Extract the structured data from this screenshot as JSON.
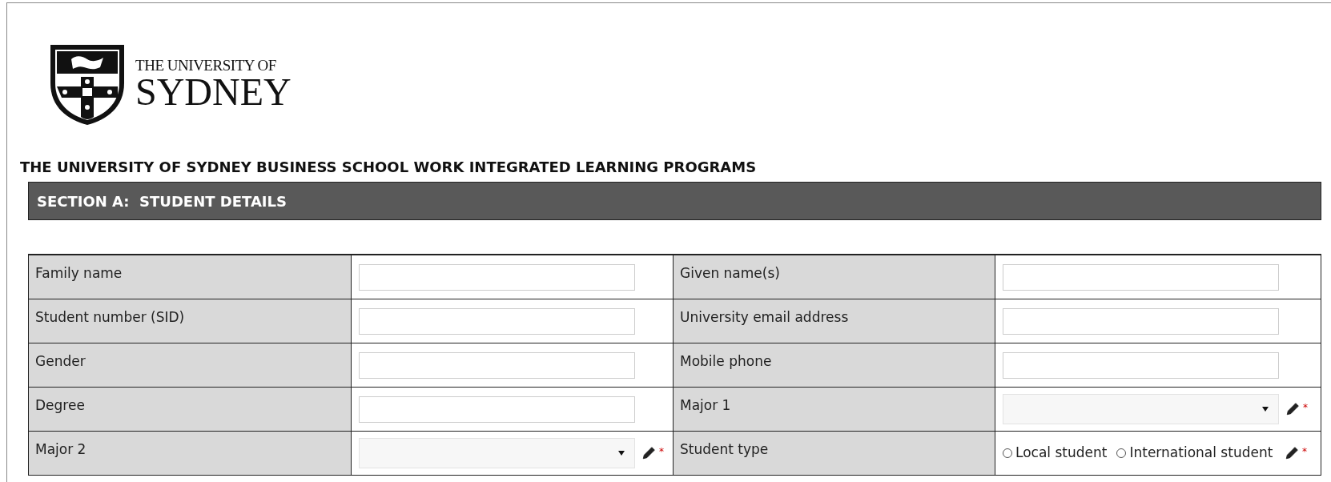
{
  "logo": {
    "line_1": "THE UNIVERSITY OF",
    "line_2": "SYDNEY"
  },
  "heading": "THE UNIVERSITY OF SYDNEY BUSINESS SCHOOL WORK INTEGRATED LEARNING PROGRAMS",
  "section_title": "SECTION A:  STUDENT DETAILS",
  "rows": [
    [
      {
        "label": "Family name",
        "kind": "text"
      },
      {
        "label": "Given name(s)",
        "kind": "text"
      }
    ],
    [
      {
        "label": "Student number (SID)",
        "kind": "text"
      },
      {
        "label": "University email address",
        "kind": "text"
      }
    ],
    [
      {
        "label": "Gender",
        "kind": "text"
      },
      {
        "label": "Mobile phone",
        "kind": "text"
      }
    ],
    [
      {
        "label": "Degree",
        "kind": "text"
      },
      {
        "label": "Major 1",
        "kind": "select",
        "required_mark": "*"
      }
    ],
    [
      {
        "label": "Major 2",
        "kind": "select",
        "required_mark": "*"
      },
      {
        "label": "Student type",
        "kind": "radio",
        "required_mark": "*",
        "options": [
          {
            "label": "Local student",
            "selected": false
          },
          {
            "label": "International student",
            "selected": false
          }
        ]
      }
    ]
  ]
}
